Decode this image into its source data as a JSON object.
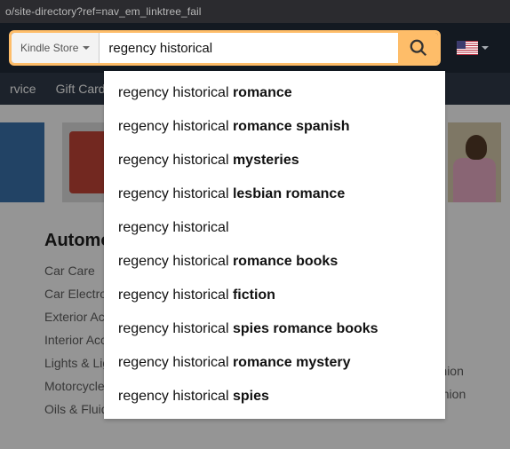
{
  "browser": {
    "url_fragment": "o/site-directory?ref=nav_em_linktree_fail"
  },
  "search": {
    "department": "Kindle Store",
    "query": "regency historical",
    "placeholder": ""
  },
  "suggestions": [
    {
      "prefix": "regency historical ",
      "suffix": "romance"
    },
    {
      "prefix": "regency historical ",
      "suffix": "romance spanish"
    },
    {
      "prefix": "regency historical ",
      "suffix": "mysteries"
    },
    {
      "prefix": "regency historical ",
      "suffix": "lesbian romance"
    },
    {
      "prefix": "regency historical",
      "suffix": ""
    },
    {
      "prefix": "regency historical ",
      "suffix": "romance books"
    },
    {
      "prefix": "regency historical ",
      "suffix": "fiction"
    },
    {
      "prefix": "regency historical ",
      "suffix": "spies romance books"
    },
    {
      "prefix": "regency historical ",
      "suffix": "romance mystery"
    },
    {
      "prefix": "regency historical ",
      "suffix": "spies"
    }
  ],
  "subnav": {
    "items": [
      "rvice",
      "Gift Cards"
    ]
  },
  "directory": {
    "left": {
      "heading": "Automotive",
      "links": [
        "Car Care",
        "Car Electronics & Accessories",
        "Exterior Accessories",
        "Interior Accessories",
        "Lights & Lighting Accessories",
        "Motorcycle & Powersports",
        "Oils & Fluids"
      ]
    },
    "right": {
      "links": [
        "Girls' Fashion",
        "Boys' Fashion"
      ]
    }
  }
}
